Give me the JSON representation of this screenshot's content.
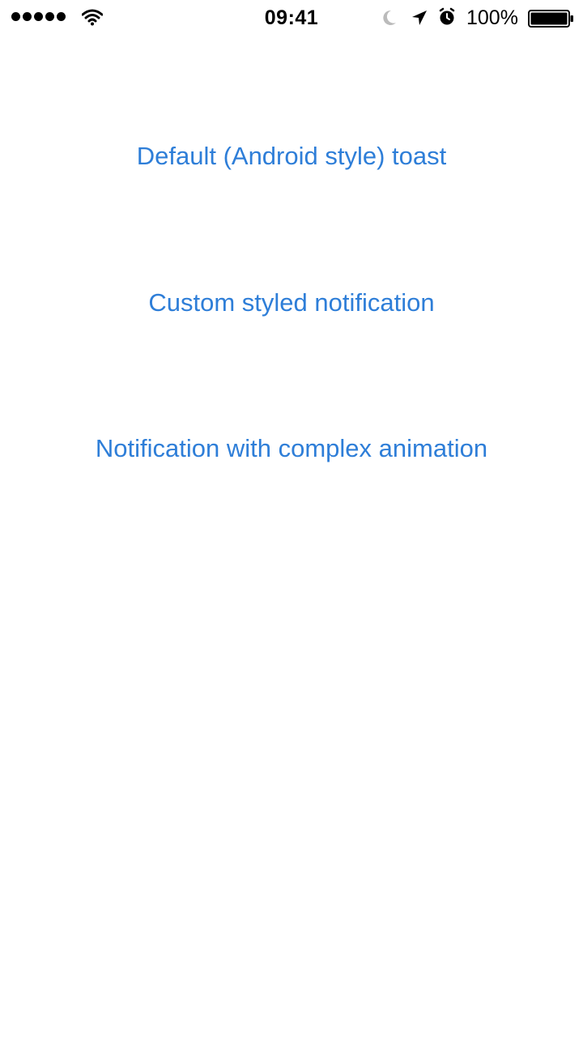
{
  "status_bar": {
    "time": "09:41",
    "battery_percent": "100%",
    "signal_dots": 5,
    "icons": [
      "signal-icon",
      "wifi-icon",
      "moon-icon",
      "location-icon",
      "alarm-icon",
      "battery-icon"
    ]
  },
  "menu": {
    "items": [
      {
        "label": "Default (Android style) toast"
      },
      {
        "label": "Custom styled notification"
      },
      {
        "label": "Notification with complex animation"
      }
    ]
  },
  "colors": {
    "accent": "#2e7ed8",
    "background": "#ffffff",
    "status_text": "#000000"
  }
}
